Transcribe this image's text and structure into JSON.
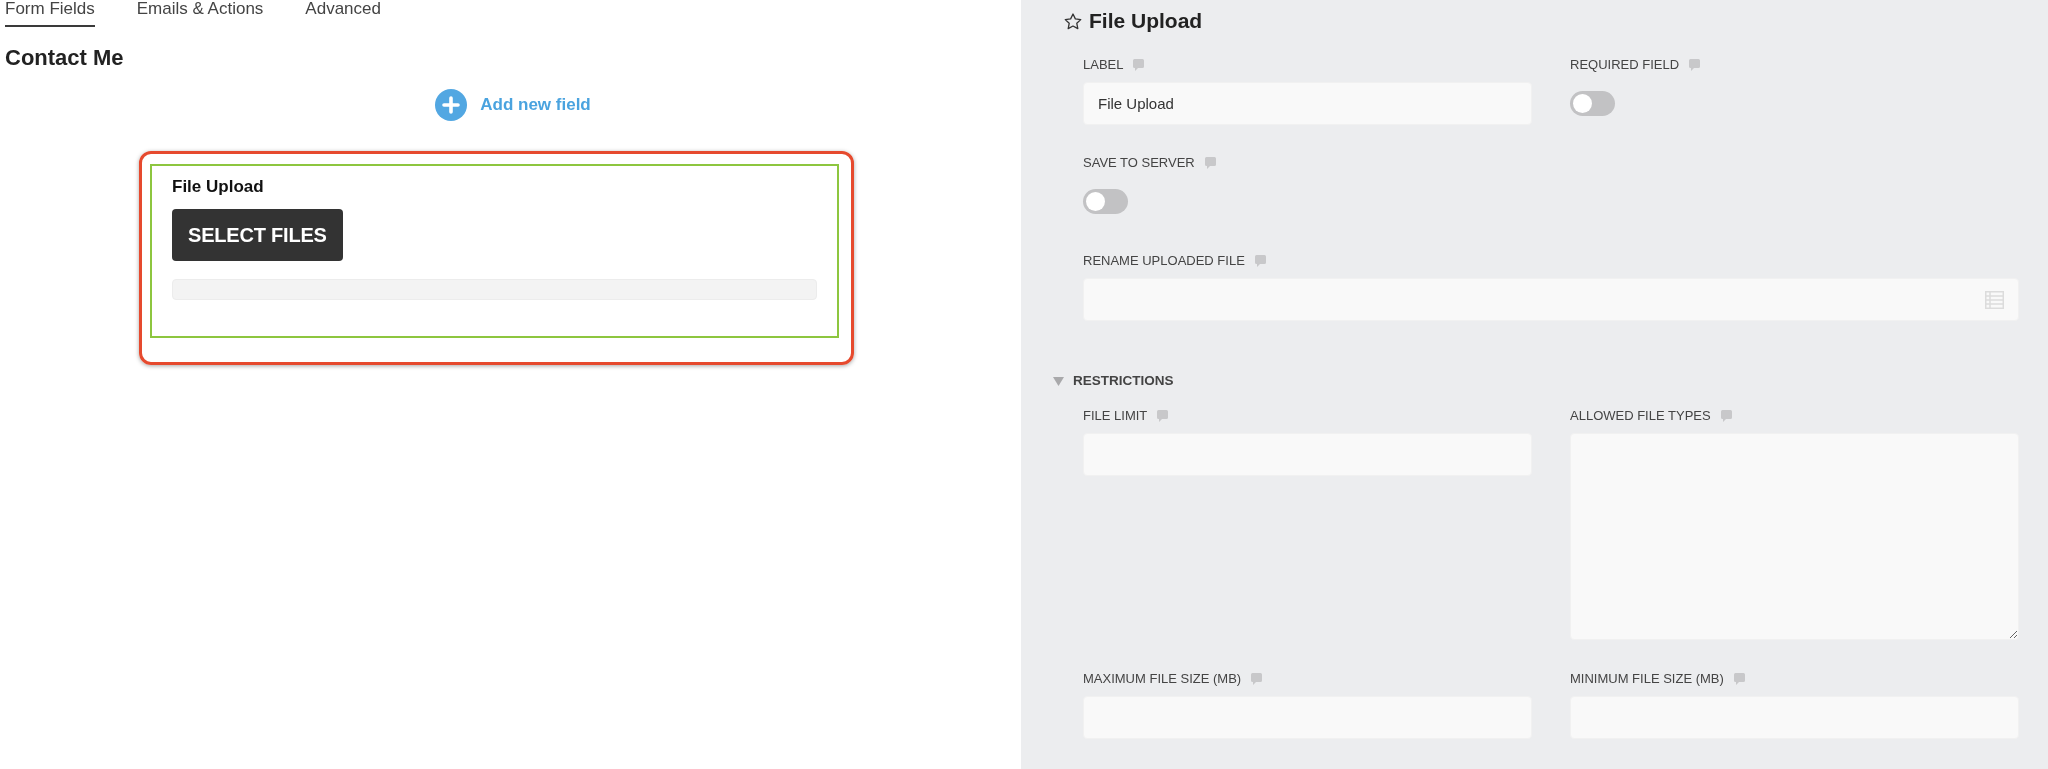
{
  "tabs": [
    {
      "label": "Form Fields",
      "selected": true
    },
    {
      "label": "Emails & Actions",
      "selected": false
    },
    {
      "label": "Advanced",
      "selected": false
    }
  ],
  "form": {
    "title": "Contact Me",
    "add_button": "Add new field",
    "fields": [
      {
        "label": "File Upload",
        "button_label": "SELECT FILES",
        "selected": true,
        "highlighted": true
      }
    ]
  },
  "settings": {
    "title": "File Upload",
    "rows": [
      [
        {
          "kind": "text",
          "label": "LABEL",
          "value": "File Upload"
        },
        {
          "kind": "toggle",
          "label": "REQUIRED FIELD",
          "on": false
        }
      ],
      [
        {
          "kind": "toggle",
          "label": "SAVE TO SERVER",
          "on": false
        }
      ],
      [
        {
          "kind": "picker",
          "label": "RENAME UPLOADED FILE"
        }
      ]
    ],
    "sections": [
      {
        "title": "RESTRICTIONS",
        "expanded": true,
        "rows": [
          [
            {
              "kind": "text",
              "label": "FILE LIMIT"
            },
            {
              "kind": "textarea",
              "label": "ALLOWED FILE TYPES"
            }
          ],
          [
            {
              "kind": "text",
              "label": "MAXIMUM FILE SIZE (MB)"
            },
            {
              "kind": "text",
              "label": "MINIMUM FILE SIZE (MB)"
            }
          ]
        ]
      }
    ]
  }
}
